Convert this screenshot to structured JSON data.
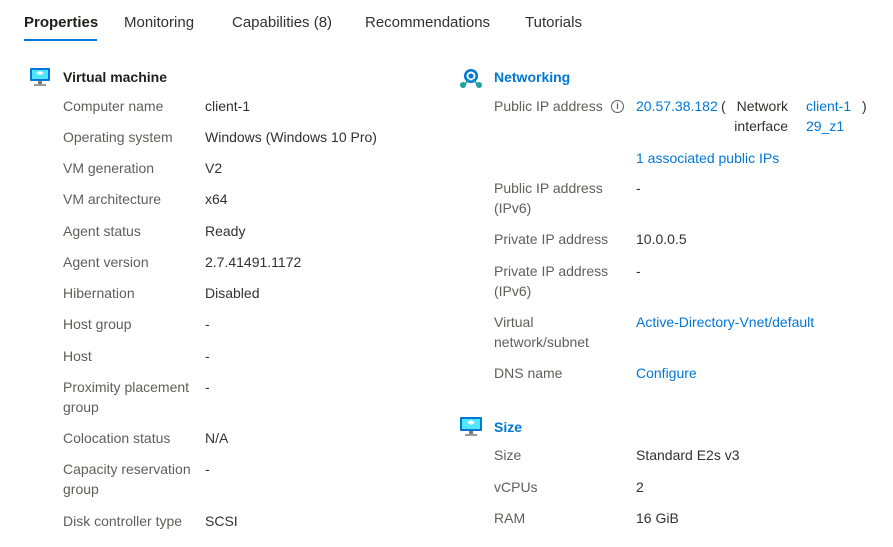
{
  "tabs": [
    {
      "label": "Properties",
      "active": true
    },
    {
      "label": "Monitoring"
    },
    {
      "label": "Capabilities (8)"
    },
    {
      "label": "Recommendations"
    },
    {
      "label": "Tutorials"
    }
  ],
  "vm": {
    "title": "Virtual machine",
    "icon": "virtual-machine-icon",
    "rows": [
      {
        "label": "Computer name",
        "value": "client-1"
      },
      {
        "label": "Operating system",
        "value": "Windows (Windows 10 Pro)"
      },
      {
        "label": "VM generation",
        "value": "V2"
      },
      {
        "label": "VM architecture",
        "value": "x64"
      },
      {
        "label": "Agent status",
        "value": "Ready"
      },
      {
        "label": "Agent version",
        "value": "2.7.41491.1172"
      },
      {
        "label": "Hibernation",
        "value": "Disabled"
      },
      {
        "label": "Host group",
        "value": "-"
      },
      {
        "label": "Host",
        "value": "-"
      },
      {
        "label": "Proximity placement group",
        "value": "-"
      },
      {
        "label": "Colocation status",
        "value": "N/A"
      },
      {
        "label": "Capacity reservation group",
        "value": "-"
      },
      {
        "label": "Disk controller type",
        "value": "SCSI"
      }
    ]
  },
  "networking": {
    "title": "Networking",
    "icon": "networking-icon",
    "public_ip": {
      "label": "Public IP address",
      "value": "20.57.38.182",
      "paren_open": "(",
      "ni_label": "Network interface",
      "ni_link": "client-129_z1",
      "paren_close": ")",
      "associated": "1 associated public IPs"
    },
    "rows": [
      {
        "label": "Public IP address (IPv6)",
        "value": "-"
      },
      {
        "label": "Private IP address",
        "value": "10.0.0.5"
      },
      {
        "label": "Private IP address (IPv6)",
        "value": "-"
      },
      {
        "label": "Virtual network/subnet",
        "value": "Active-Directory-Vnet/default",
        "link": true
      },
      {
        "label": "DNS name",
        "value": "Configure",
        "link": true
      }
    ]
  },
  "size": {
    "title": "Size",
    "icon": "size-icon",
    "rows": [
      {
        "label": "Size",
        "value": "Standard E2s v3"
      },
      {
        "label": "vCPUs",
        "value": "2"
      },
      {
        "label": "RAM",
        "value": "16 GiB"
      }
    ]
  },
  "colors": {
    "accent": "#0078d4",
    "label": "#605e5c",
    "text": "#323130"
  }
}
